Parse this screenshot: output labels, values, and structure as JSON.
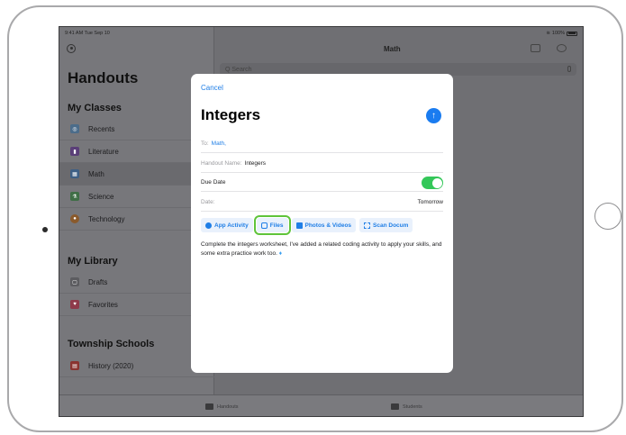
{
  "status_bar": {
    "time": "9:41 AM  Tue Sep 10",
    "battery": "100%"
  },
  "sidebar": {
    "title": "Handouts",
    "sections": [
      {
        "header": "My Classes",
        "items": [
          {
            "label": "Recents",
            "icon": "recents-icon",
            "color": "#5aa9e6"
          },
          {
            "label": "Literature",
            "icon": "literature-icon",
            "color": "#9b59d0"
          },
          {
            "label": "Math",
            "icon": "math-icon",
            "color": "#4a8fe0",
            "selected": true
          },
          {
            "label": "Science",
            "icon": "science-icon",
            "color": "#5cb85c"
          },
          {
            "label": "Technology",
            "icon": "technology-icon",
            "color": "#f08a24"
          }
        ]
      },
      {
        "header": "My Library",
        "items": [
          {
            "label": "Drafts",
            "icon": "drafts-icon",
            "color": "#8e8e93"
          },
          {
            "label": "Favorites",
            "icon": "heart-icon",
            "color": "#ff3b5c"
          }
        ]
      },
      {
        "header": "Township Schools",
        "items": [
          {
            "label": "History (2020)",
            "icon": "history-icon",
            "color": "#e8453c"
          }
        ]
      }
    ]
  },
  "detail": {
    "title": "Math",
    "search_placeholder": "Q Search"
  },
  "tabs": {
    "handouts": "Handouts",
    "students": "Students"
  },
  "modal": {
    "cancel": "Cancel",
    "title": "Integers",
    "to_label": "To:",
    "to_value": "Math,",
    "handout_name_label": "Handout Name:",
    "handout_name_value": "Integers",
    "due_date_label": "Due Date",
    "due_date_enabled": true,
    "date_label": "Date:",
    "date_value": "Tomorrow",
    "attach": {
      "app_activity": "App Activity",
      "files": "Files",
      "photos_videos": "Photos & Videos",
      "scan": "Scan Docum"
    },
    "body": "Complete the integers worksheet, I've added a related coding activity to apply your skills, and some extra practice work too."
  },
  "colors": {
    "accent": "#1f7ee6",
    "toggle_on": "#34c759",
    "highlight": "#5fc43a"
  }
}
